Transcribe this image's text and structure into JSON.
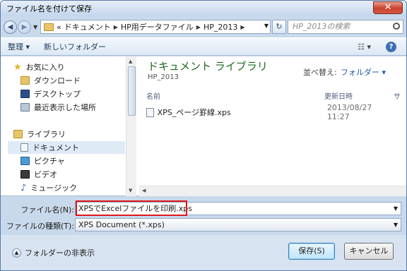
{
  "window": {
    "title": "ファイル名を付けて保存"
  },
  "address": {
    "prefix": "«",
    "crumbs": [
      "ドキュメント",
      "HP用データファイル",
      "HP_2013"
    ],
    "search_placeholder": "HP_2013の検索"
  },
  "toolbar": {
    "organize": "整理 ▾",
    "new_folder": "新しいフォルダー"
  },
  "nav": {
    "favorites": "お気に入り",
    "downloads": "ダウンロード",
    "desktop": "デスクトップ",
    "recent": "最近表示した場所",
    "libraries": "ライブラリ",
    "documents": "ドキュメント",
    "pictures": "ピクチャ",
    "videos": "ビデオ",
    "music": "ミュージック"
  },
  "library": {
    "title": "ドキュメント ライブラリ",
    "subtitle": "HP_2013",
    "sort_label": "並べ替え:",
    "sort_value": "フォルダー ▾"
  },
  "columns": {
    "name": "名前",
    "date": "更新日時",
    "type_partial": "サ"
  },
  "files": [
    {
      "name": "XPS_ページ罫線.xps",
      "date": "2013/08/27 11:27"
    }
  ],
  "form": {
    "filename_label": "ファイル名(N):",
    "filename_value": "XPSでExcelファイルを印刷.xps",
    "filetype_label": "ファイルの種類(T):",
    "filetype_value": "XPS Document (*.xps)"
  },
  "footer": {
    "hide_folders": "フォルダーの非表示",
    "save": "保存(S)",
    "cancel": "キャンセル"
  }
}
